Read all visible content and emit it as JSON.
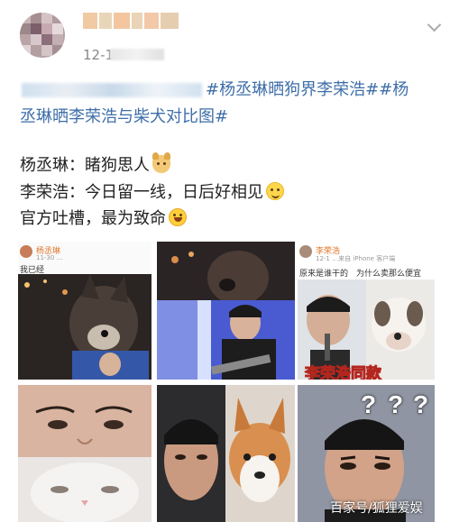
{
  "post": {
    "time": "12-1",
    "topics_line1": "#杨丞琳晒狗界李荣浩##杨",
    "topics_line2": "丞琳晒李荣浩与柴犬对比图#",
    "line_yang": "杨丞琳：睹狗思人",
    "line_li": "李荣浩：今日留一线，日后好相见",
    "line_official": "官方吐槽，最为致命"
  },
  "images": {
    "img1": {
      "name": "杨丞琳",
      "date": "11-30 …",
      "caption": "我已经"
    },
    "img3": {
      "name": "李荣浩",
      "date": "12-1 …来自 iPhone 客户端",
      "caption": "原来是谁干的　为什么卖那么便宜",
      "banner": "李荣浩同款"
    },
    "img6": {
      "marks": [
        "?",
        "?",
        "?"
      ]
    }
  },
  "watermark": "百家号/狐狸爱娱",
  "colors": {
    "topic": "#3e6ea8",
    "text": "#222222",
    "time": "#888888"
  },
  "icons": [
    "chevron-down-icon",
    "dog-emoji-icon",
    "smile-emoji-icon",
    "laugh-emoji-icon"
  ]
}
